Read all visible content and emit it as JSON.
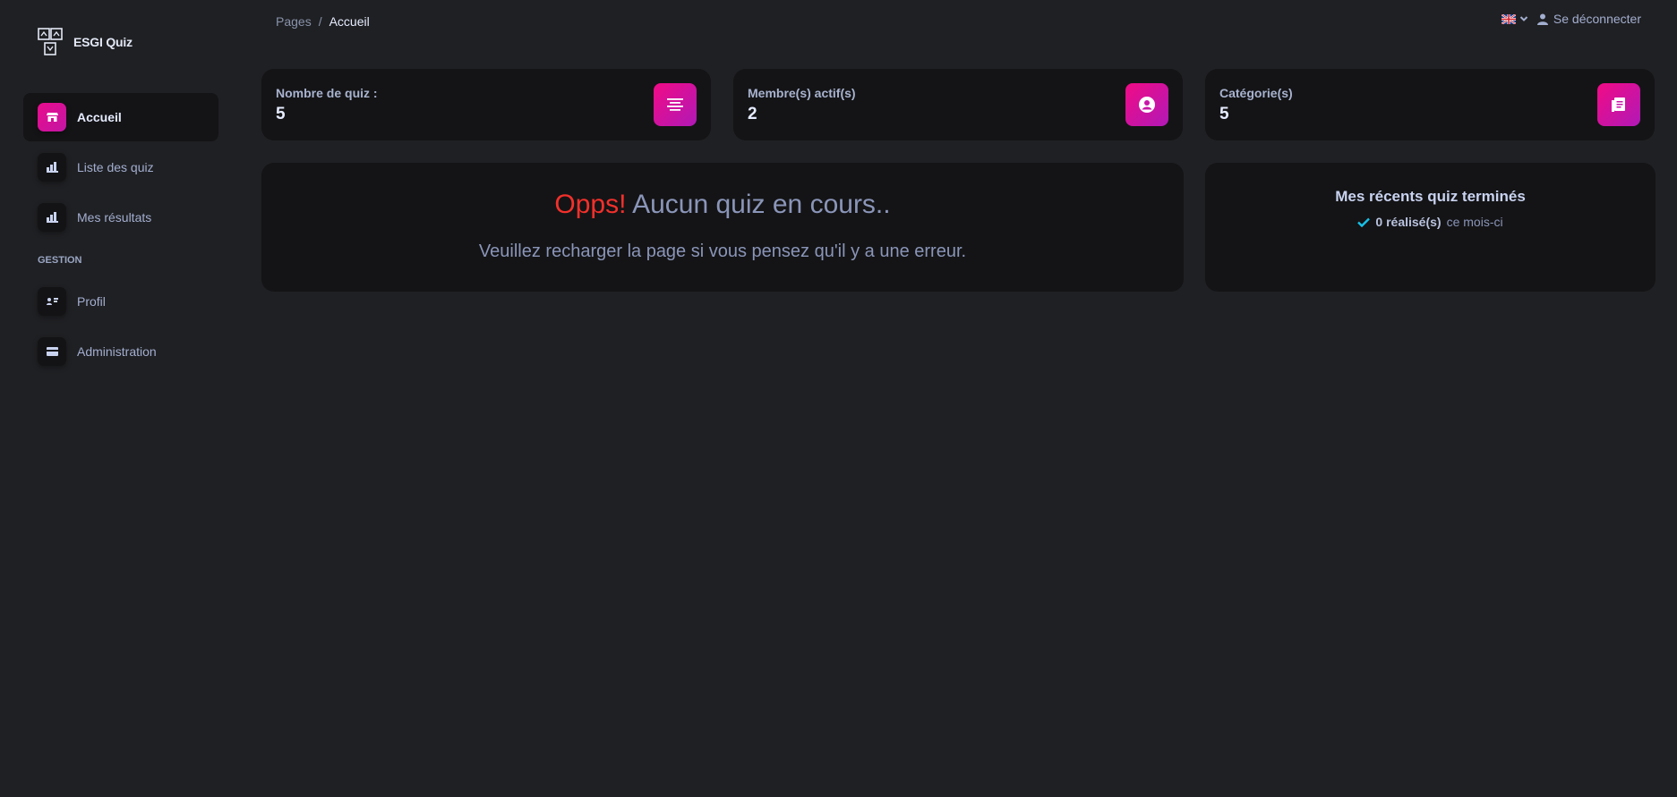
{
  "brand": {
    "name": "ESGI Quiz",
    "logo_icon": "quiz-logo-icon"
  },
  "sidebar": {
    "items": [
      {
        "label": "Accueil",
        "icon": "store-icon",
        "active": true
      },
      {
        "label": "Liste des quiz",
        "icon": "chart-icon",
        "active": false
      },
      {
        "label": "Mes résultats",
        "icon": "chart-icon",
        "active": false
      }
    ],
    "section_title": "GESTION",
    "gestion_items": [
      {
        "label": "Profil",
        "icon": "user-card-icon"
      },
      {
        "label": "Administration",
        "icon": "card-icon"
      }
    ]
  },
  "breadcrumb": {
    "root": "Pages",
    "separator": "/",
    "current": "Accueil"
  },
  "topbar": {
    "language_flag": "uk-flag-icon",
    "logout_label": "Se déconnecter"
  },
  "stats": [
    {
      "label": "Nombre de quiz :",
      "value": "5",
      "icon": "list-icon"
    },
    {
      "label": "Membre(s) actif(s)",
      "value": "2",
      "icon": "user-circle-icon"
    },
    {
      "label": "Catégorie(s)",
      "value": "5",
      "icon": "document-icon"
    }
  ],
  "empty_state": {
    "highlight": "Opps!",
    "title": " Aucun quiz en cours..",
    "message": "Veuillez recharger la page si vous pensez qu'il y a une erreur."
  },
  "recent": {
    "title": "Mes récents quiz terminés",
    "count_text": "0 réalisé(s)",
    "period_text": "ce mois-ci"
  },
  "colors": {
    "accent": "#e90c8c",
    "accent2": "#b019b7",
    "error": "#f3302b",
    "background": "#1f2023",
    "card": "#141416"
  }
}
